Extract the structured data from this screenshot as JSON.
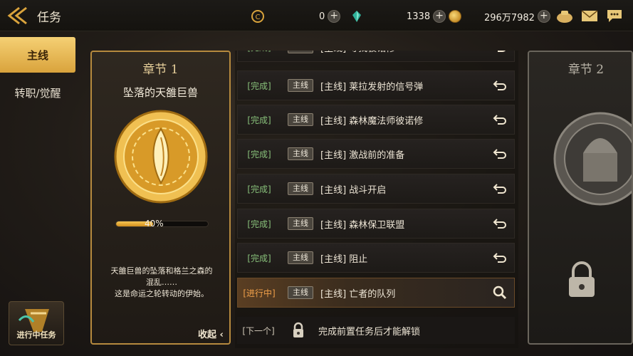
{
  "header": {
    "title": "任务"
  },
  "resources": {
    "currency1": "0",
    "gems": "1338",
    "gold": "296万7982"
  },
  "sidebar": {
    "tabs": [
      {
        "label": "主线"
      },
      {
        "label": "转职/觉醒"
      }
    ],
    "in_progress_label": "进行中任务"
  },
  "chapter1": {
    "header": "章节 1",
    "title": "坠落的天雒巨兽",
    "progress": 0.4,
    "progress_label": "40%",
    "desc_line1": "天雒巨兽的坠落和格兰之森的",
    "desc_line2": "混乱……",
    "desc_line3": "这是命运之轮转动的伊始。",
    "collapse_label": "收起"
  },
  "chapter2": {
    "header": "章节 2"
  },
  "quests": [
    {
      "status": "[完成]",
      "tag": "主线",
      "title": "[主线] 寻找彼诺修",
      "action": "return-icon"
    },
    {
      "status": "[完成]",
      "tag": "主线",
      "title": "[主线] 莱拉发射的信号弹",
      "action": "return-icon"
    },
    {
      "status": "[完成]",
      "tag": "主线",
      "title": "[主线] 森林魔法师彼诺修",
      "action": "return-icon"
    },
    {
      "status": "[完成]",
      "tag": "主线",
      "title": "[主线] 激战前的准备",
      "action": "return-icon"
    },
    {
      "status": "[完成]",
      "tag": "主线",
      "title": "[主线] 战斗开启",
      "action": "return-icon"
    },
    {
      "status": "[完成]",
      "tag": "主线",
      "title": "[主线] 森林保卫联盟",
      "action": "return-icon"
    },
    {
      "status": "[完成]",
      "tag": "主线",
      "title": "[主线] 阻止",
      "action": "return-icon"
    },
    {
      "status": "[进行中]",
      "tag": "主线",
      "title": "[主线] 亡者的队列",
      "action": "search-icon"
    }
  ],
  "next_quest": {
    "label": "[下一个]",
    "text": "完成前置任务后才能解锁"
  },
  "colors": {
    "gold_accent": "#d9a33c",
    "complete_green": "#88c07a",
    "in_progress_orange": "#f0a04a"
  }
}
